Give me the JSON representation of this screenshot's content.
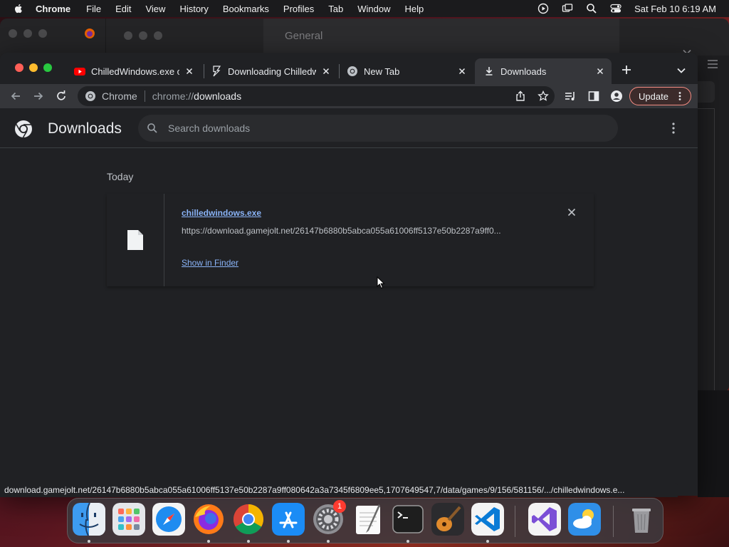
{
  "menubar": {
    "app_name": "Chrome",
    "items": [
      "File",
      "Edit",
      "View",
      "History",
      "Bookmarks",
      "Profiles",
      "Tab",
      "Window",
      "Help"
    ],
    "clock": "Sat Feb 10  6:19 AM"
  },
  "background_window": {
    "title": "General"
  },
  "browser": {
    "tabs": [
      {
        "title": "ChilledWindows.exe o",
        "favicon": "youtube-icon",
        "active": false
      },
      {
        "title": "Downloading Chilledw",
        "favicon": "gamejolt-icon",
        "active": false
      },
      {
        "title": "New Tab",
        "favicon": "chrome-icon",
        "active": false
      },
      {
        "title": "Downloads",
        "favicon": "download-icon",
        "active": true
      }
    ],
    "omnibox": {
      "site_chip": "Chrome",
      "url_scheme": "chrome://",
      "url_host": "downloads"
    },
    "update_label": "Update"
  },
  "downloads_page": {
    "title": "Downloads",
    "search_placeholder": "Search downloads",
    "date_heading": "Today",
    "items": [
      {
        "file_name": "chilledwindows.exe",
        "url": "https://download.gamejolt.net/26147b6880b5abca055a61006ff5137e50b2287a9ff0...",
        "action": "Show in Finder"
      }
    ]
  },
  "status_bar": {
    "text": "download.gamejolt.net/26147b6880b5abca055a61006ff5137e50b2287a9ff080642a3a7345f6809ee5,1707649547,7/data/games/9/156/581156/.../chilledwindows.e..."
  },
  "dock": {
    "apps": [
      "Finder",
      "Launchpad",
      "Safari",
      "Firefox",
      "Google Chrome",
      "App Store",
      "System Settings",
      "TextEdit",
      "Terminal",
      "GarageBand",
      "Visual Studio Code",
      "Visual Studio",
      "Weather",
      "Trash"
    ],
    "settings_badge": "1"
  },
  "colors": {
    "accent_link": "#8ab4f8",
    "update_border": "#f28b82",
    "page_bg": "#202124",
    "toolbar_bg": "#35363a"
  }
}
